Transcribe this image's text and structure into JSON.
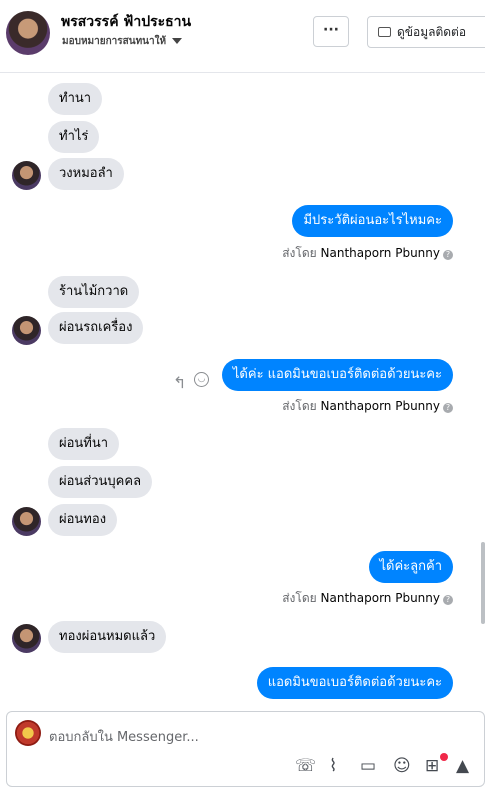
{
  "header": {
    "name": "พรสวรรค์ ฟ้าประธาน",
    "subtitle": "มอบหมายการสนทนาให้",
    "more_label": "···",
    "contact_label": "ดูข้อมูลติดต่อ"
  },
  "messages": [
    {
      "from": "customer",
      "text": "ทำนา"
    },
    {
      "from": "customer",
      "text": "ทำไร่"
    },
    {
      "from": "customer",
      "text": "วงหมอลำ"
    },
    {
      "from": "page",
      "text": "มีประวัติผ่อนอะไรไหมคะ"
    },
    {
      "from": "customer",
      "text": "ร้านไม้กวาด"
    },
    {
      "from": "customer",
      "text": "ผ่อนรถเครื่อง"
    },
    {
      "from": "page",
      "text": "ได้ค่ะ แอดมินขอเบอร์ติดต่อด้วยนะคะ"
    },
    {
      "from": "customer",
      "text": "ผ่อนที่นา"
    },
    {
      "from": "customer",
      "text": "ผ่อนส่วนบุคคล"
    },
    {
      "from": "customer",
      "text": "ผ่อนทอง"
    },
    {
      "from": "page",
      "text": "ได้ค่ะลูกค้า"
    },
    {
      "from": "customer",
      "text": "ทองผ่อนหมดแล้ว"
    },
    {
      "from": "page",
      "text": "แอดมินขอเบอร์ติดต่อด้วยนะคะ"
    }
  ],
  "sent_by": {
    "prefix": "ส่งโดย",
    "agent": "Nanthaporn Pbunny",
    "info_icon": "?"
  },
  "composer": {
    "placeholder": "ตอบกลับใน Messenger...",
    "tools": [
      "phone-add-icon",
      "paperclip-icon",
      "chat-bubble-icon",
      "emoji-icon",
      "cart-icon",
      "thumbs-up-icon"
    ]
  },
  "colors": {
    "outgoing": "#0084ff",
    "incoming": "#e4e6eb",
    "notification_dot": "#f02849"
  }
}
